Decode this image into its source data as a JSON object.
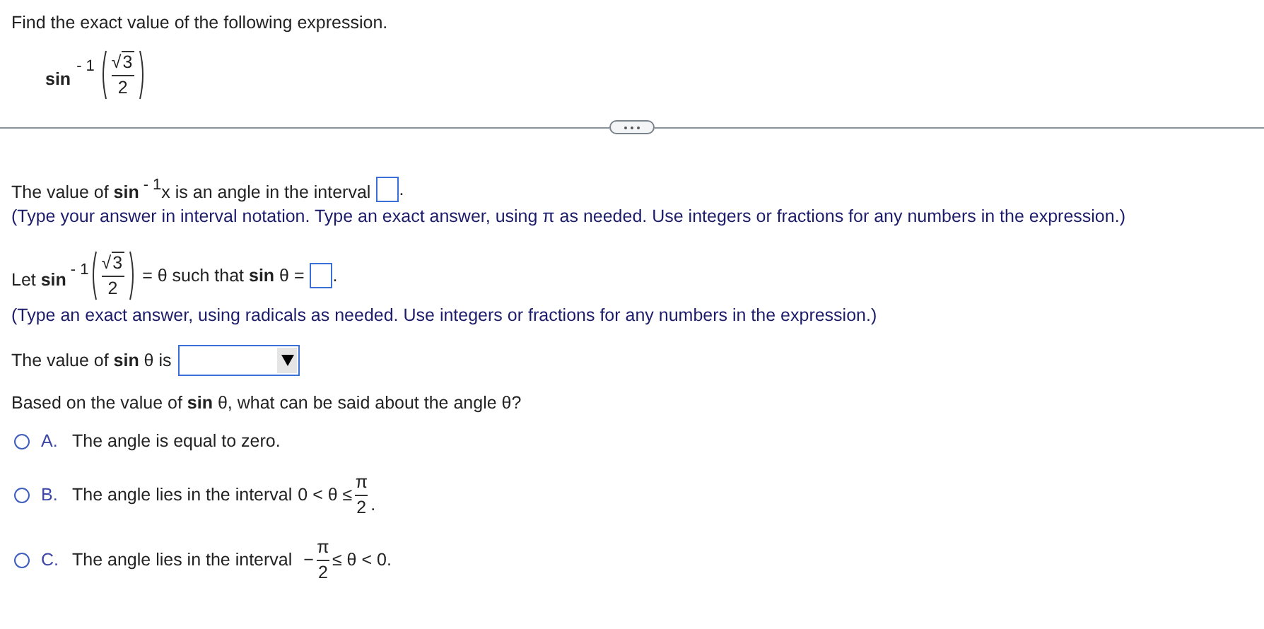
{
  "prompt": "Find the exact value of the following expression.",
  "expression": {
    "func": "sin",
    "exponent": "- 1",
    "radical": "√",
    "radicand": "3",
    "denominator": "2"
  },
  "interval_step": {
    "text": "The value of **sin**$^{- 1}$x is an angle in the interval",
    "end": ".",
    "hint": "(Type your answer in interval notation. Type an exact answer, using π as needed. Use integers or fractions for any numbers in the expression.)"
  },
  "theta_step": {
    "lead": "Let **sin**$^{- 1}$",
    "radical": "√",
    "radicand": "3",
    "denominator": "2",
    "middle": "= θ such that **sin** θ =",
    "end": ".",
    "hint": "(Type an exact answer, using radicals as needed. Use integers or fractions for any numbers in the expression.)"
  },
  "sign_step": {
    "text": "The value of **sin** θ is"
  },
  "question": "Based on the value of **sin** θ, what can be said about the angle θ?",
  "options": [
    {
      "letter": "A.",
      "kind": "plain",
      "text": "The angle is equal to zero.",
      "selected": false
    },
    {
      "letter": "B.",
      "kind": "fraction_end",
      "text": "The angle lies in the interval",
      "before": "0 < θ ≤",
      "numerator": "π",
      "denominator": "2",
      "after": ".",
      "selected": false
    },
    {
      "letter": "C.",
      "kind": "fraction_middle",
      "text": "The angle lies in the interval",
      "before": "−",
      "numerator": "π",
      "denominator": "2",
      "after": "≤ θ < 0.",
      "selected": false
    }
  ]
}
